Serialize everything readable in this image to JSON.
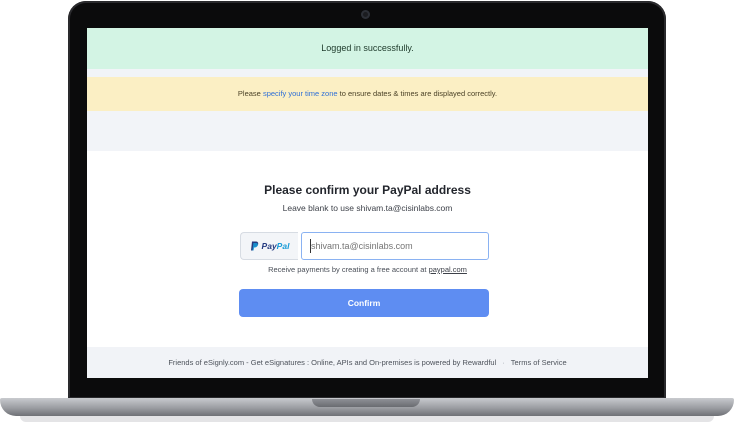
{
  "alerts": {
    "success_text": "Logged in successfully.",
    "warning_prefix": "Please ",
    "warning_link": "specify your time zone",
    "warning_suffix": " to ensure dates & times are displayed correctly."
  },
  "form": {
    "title": "Please confirm your PayPal address",
    "subtitle": "Leave blank to use shivam.ta@cisinlabs.com",
    "badge": {
      "pay": "Pay",
      "pal": "Pal",
      "icon": "paypal-icon"
    },
    "email_placeholder": "shivam.ta@cisinlabs.com",
    "helper_prefix": "Receive payments by creating a free account at ",
    "helper_link": "paypal.com",
    "confirm_label": "Confirm"
  },
  "footer": {
    "text": "Friends of eSignly.com - Get eSignatures : Online, APIs and On-premises is powered by Rewardful",
    "separator": "·",
    "terms_label": "Terms of Service"
  },
  "colors": {
    "success_bg": "#d3f4e4",
    "warning_bg": "#fbefc4",
    "button_bg": "#5e8df2",
    "link": "#2f6fd6",
    "paypal_dark": "#253b80",
    "paypal_light": "#179bd7"
  }
}
